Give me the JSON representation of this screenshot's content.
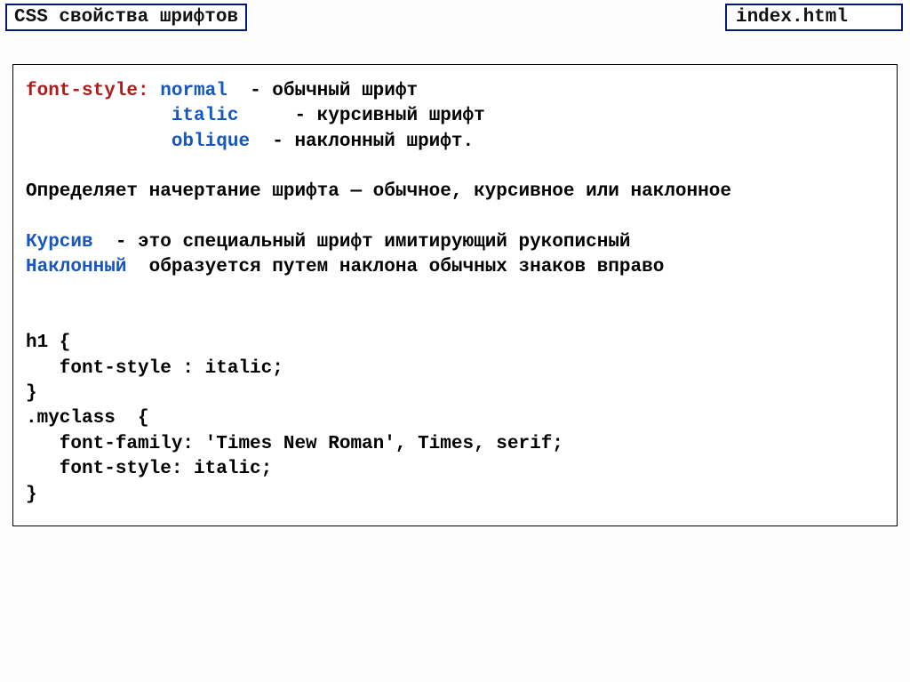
{
  "title": "CSS свойства шрифтов",
  "filename": "index.html",
  "code": {
    "l1_prop": "font-style:",
    "l1_val": "normal",
    "l1_desc": "  - обычный шрифт",
    "l2_val": "italic",
    "l2_desc": "     - курсивный шрифт",
    "l3_val": "oblique",
    "l3_desc": "  - наклонный шрифт.",
    "summary": "Определяет начертание шрифта — обычное, курсивное или наклонное",
    "kw1": "Курсив",
    "kw1_rest": "  - это специальный шрифт имитирующий рукописный",
    "kw2": "Наклонный",
    "kw2_rest": "  образуется путем наклона обычных знаков вправо",
    "ex1": "h1 {",
    "ex2": "   font-style : italic;",
    "ex3": "}",
    "ex4": ".myclass  {",
    "ex5": "   font-family: 'Times New Roman', Times, serif;",
    "ex6": "   font-style: italic;",
    "ex7": "}"
  }
}
